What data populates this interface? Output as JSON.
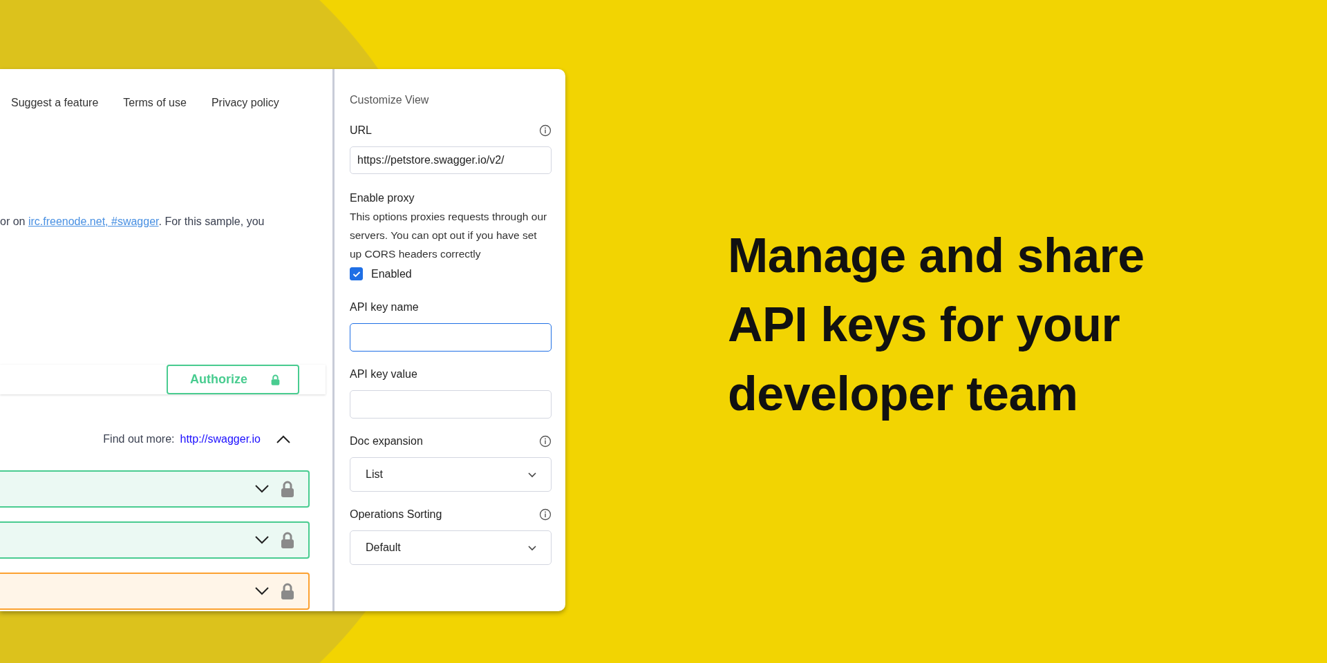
{
  "nav_links": [
    "Suggest a feature",
    "Terms of use",
    "Privacy policy"
  ],
  "description": {
    "before": "or on ",
    "link": "irc.freenode.net, #swagger",
    "after": ". For this sample, you"
  },
  "authorize_button": "Authorize",
  "find_out_more": {
    "label": "Find out more:",
    "link": "http://swagger.io"
  },
  "operations": [
    {
      "color": "#49cc90"
    },
    {
      "color": "#49cc90"
    },
    {
      "color": "#fca130"
    }
  ],
  "customize_view": {
    "title": "Customize View",
    "url": {
      "label": "URL",
      "value": "https://petstore.swagger.io/v2/"
    },
    "proxy": {
      "label": "Enable proxy",
      "description": "This options proxies requests through our servers. You can opt out if you have set up CORS headers correctly",
      "checkbox_label": "Enabled",
      "checked": true
    },
    "api_key_name": {
      "label": "API key name",
      "focused": true
    },
    "api_key_value": {
      "label": "API key value",
      "focused": false
    },
    "doc_expansion": {
      "label": "Doc expansion",
      "value": "List"
    },
    "operations_sorting": {
      "label": "Operations Sorting",
      "value": "Default"
    }
  },
  "headline": "Manage and share API keys for your developer team"
}
